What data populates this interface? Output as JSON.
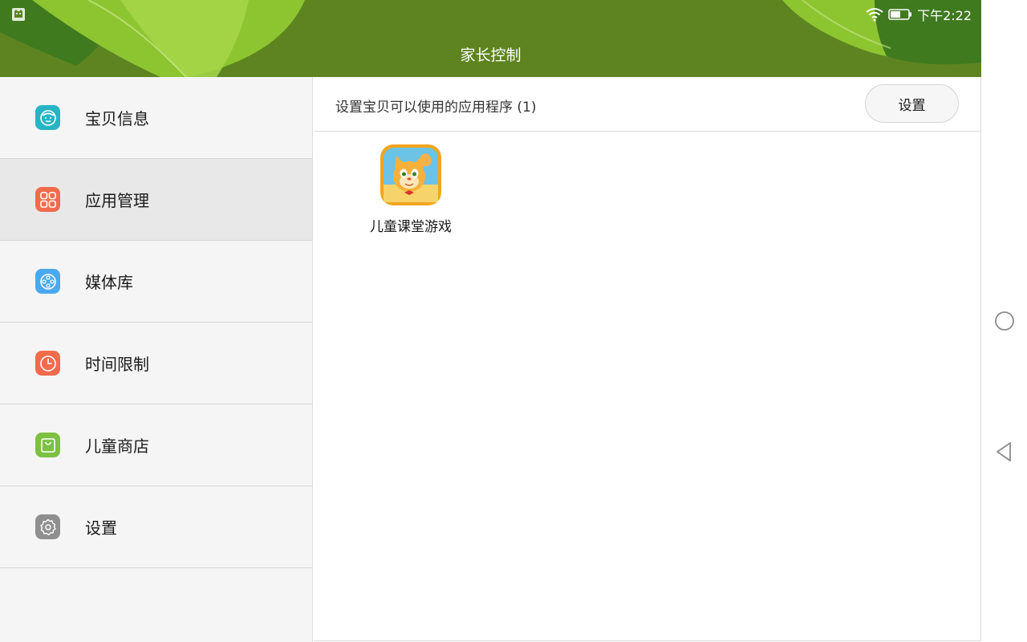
{
  "status_bar": {
    "time": "下午2:22",
    "icons": [
      "cat-notification-icon",
      "wifi-icon",
      "battery-icon"
    ]
  },
  "header": {
    "title": "家长控制"
  },
  "sidebar": {
    "items": [
      {
        "label": "宝贝信息",
        "icon": "baby-face-icon",
        "color": "#27b4c4",
        "active": false
      },
      {
        "label": "应用管理",
        "icon": "app-grid-icon",
        "color": "#f26b4c",
        "active": true
      },
      {
        "label": "媒体库",
        "icon": "film-reel-icon",
        "color": "#4aa9ee",
        "active": false
      },
      {
        "label": "时间限制",
        "icon": "clock-icon",
        "color": "#f26b4c",
        "active": false
      },
      {
        "label": "儿童商店",
        "icon": "shopping-bag-icon",
        "color": "#7dc142",
        "active": false
      },
      {
        "label": "设置",
        "icon": "gear-icon",
        "color": "#8f8f8f",
        "active": false
      }
    ]
  },
  "main": {
    "header_title": "设置宝贝可以使用的应用程序 (1)",
    "settings_button": "设置",
    "apps": [
      {
        "label": "儿童课堂游戏",
        "icon": "cartoon-cat-app-icon"
      }
    ]
  },
  "colors": {
    "header_green": "#5e8421",
    "leaf_light": "#8dc531",
    "leaf_dark": "#3f7a1f",
    "sidebar_bg": "#f5f5f5",
    "sidebar_active_bg": "#e8e8e8"
  }
}
